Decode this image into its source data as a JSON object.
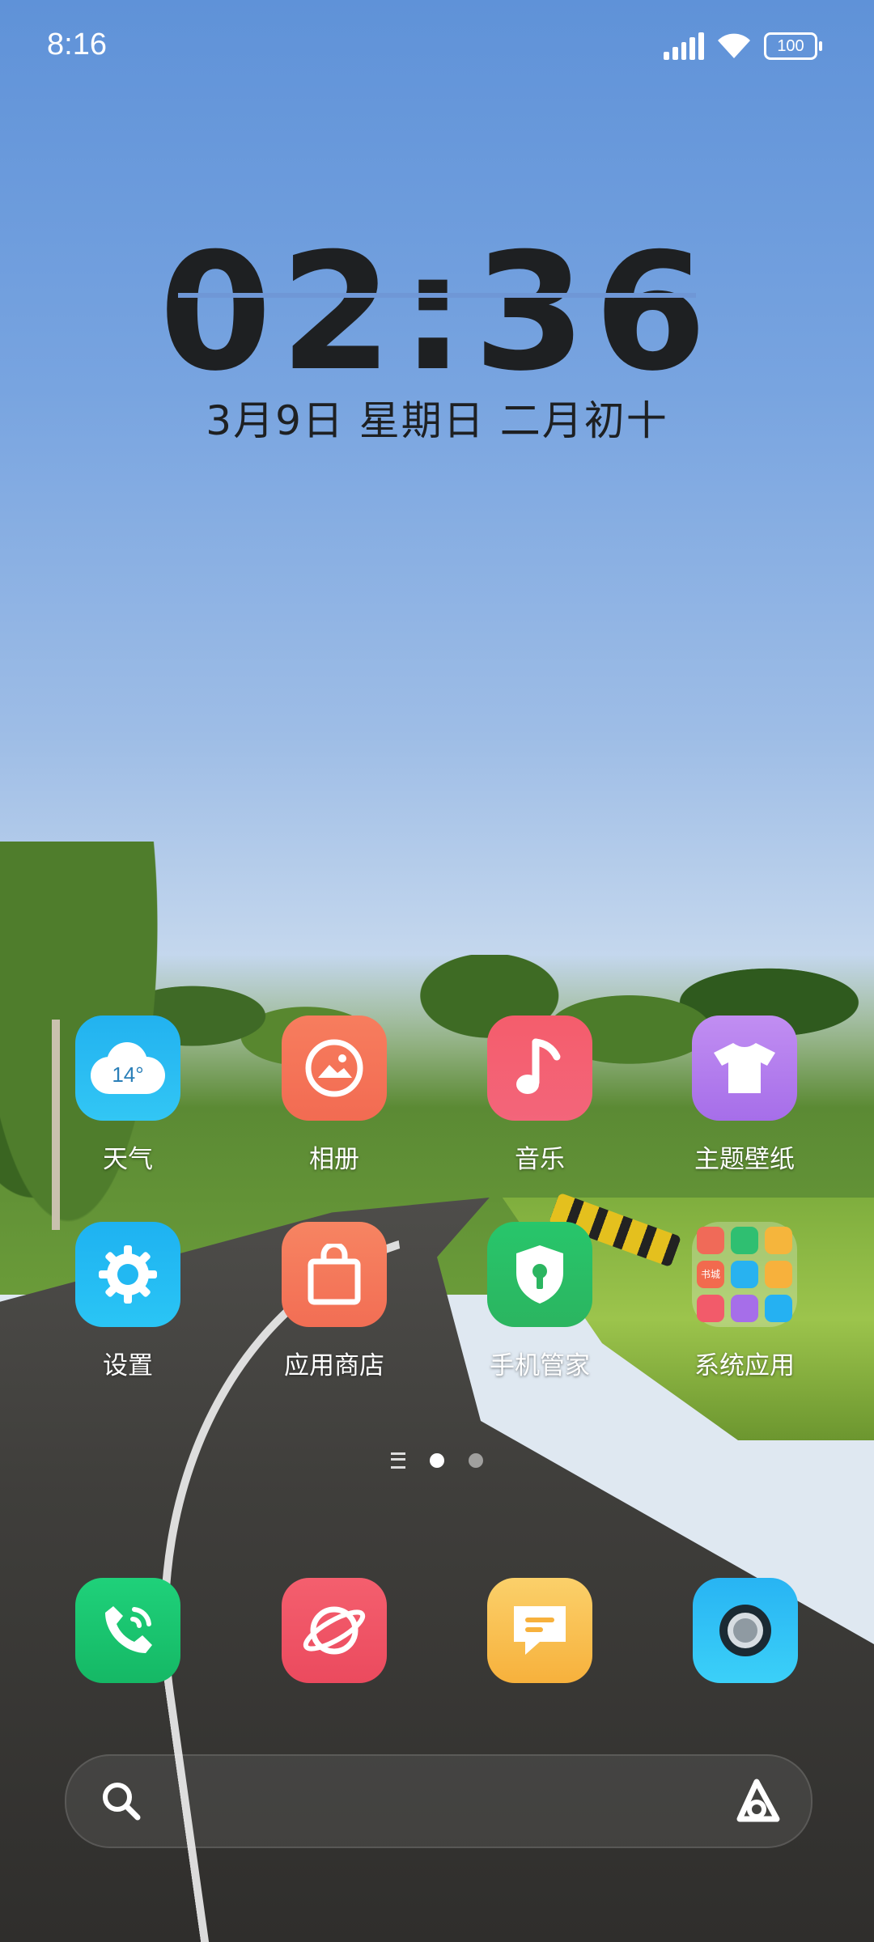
{
  "status_bar": {
    "time": "8:16",
    "battery": "100"
  },
  "clock_widget": {
    "time": "02:36",
    "date": "3月9日  星期日  二月初十"
  },
  "apps": [
    {
      "label": "天气",
      "temp": "14°"
    },
    {
      "label": "相册"
    },
    {
      "label": "音乐"
    },
    {
      "label": "主题壁纸"
    },
    {
      "label": "设置"
    },
    {
      "label": "应用商店"
    },
    {
      "label": "手机管家"
    },
    {
      "label": "系统应用"
    }
  ],
  "folder_badge": "书城",
  "dock": [
    {
      "name": "phone"
    },
    {
      "name": "browser"
    },
    {
      "name": "messages"
    },
    {
      "name": "camera"
    }
  ],
  "page_indicator": {
    "pages": 2,
    "current": 1
  },
  "colors": {
    "accent_blue": "#2ac5f5",
    "green": "#1fd17a",
    "red": "#eb4a5e",
    "yellow": "#f7b13c"
  }
}
